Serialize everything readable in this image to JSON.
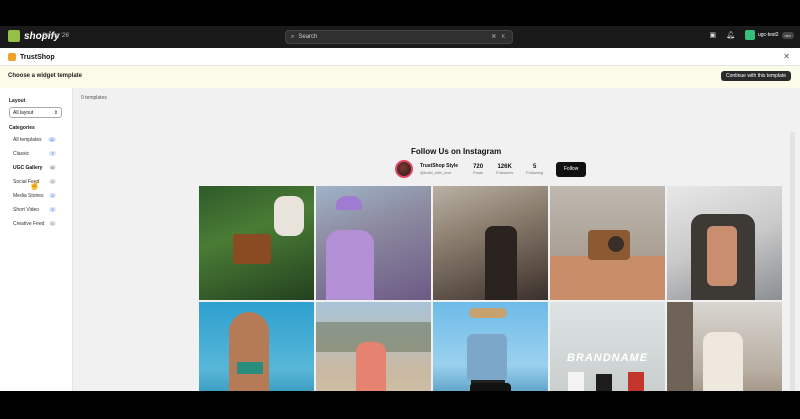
{
  "shopify": {
    "logo_text": "shopify",
    "edition": "Spring '26",
    "search_placeholder": "Search",
    "search_shortcut": "⌘ K",
    "user_name": "ugc-test2",
    "dev_tag": "dev"
  },
  "app": {
    "name": "TrustShop",
    "choose_title": "Choose a widget template",
    "continue_label": "Continue with this template"
  },
  "sidebar": {
    "layout_heading": "Layout",
    "layout_value": "All layout",
    "categories_heading": "Categories",
    "categories": [
      {
        "label": "All templates",
        "count": "11"
      },
      {
        "label": "Classic",
        "count": "7"
      },
      {
        "label": "UGC Gallery",
        "count": "0"
      },
      {
        "label": "Social Feed",
        "count": "0"
      },
      {
        "label": "Media Stories",
        "count": "2"
      },
      {
        "label": "Short Video",
        "count": "2"
      },
      {
        "label": "Creative Feed",
        "count": "0"
      }
    ]
  },
  "main": {
    "templates_count": "0 templates",
    "widget_title": "Follow Us on Instagram",
    "profile_name": "TrustShop Style",
    "profile_handle": "@build_with_love",
    "stats": [
      {
        "value": "720",
        "label": "Posts"
      },
      {
        "value": "126K",
        "label": "Followers"
      },
      {
        "value": "5",
        "label": "Following"
      }
    ],
    "follow_label": "Follow",
    "brand_text": "BRANDNAME"
  }
}
